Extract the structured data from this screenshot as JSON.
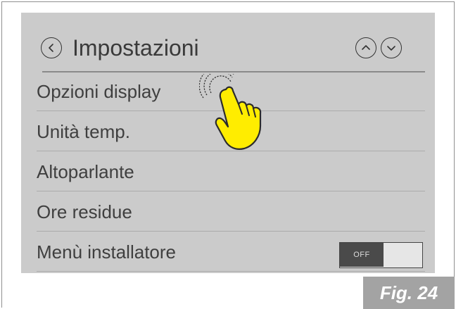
{
  "header": {
    "title": "Impostazioni",
    "icons": {
      "back": "chevron-left-icon",
      "up": "chevron-up-icon",
      "down": "chevron-down-icon"
    }
  },
  "menu": {
    "items": [
      {
        "label": "Opzioni display"
      },
      {
        "label": "Unità temp."
      },
      {
        "label": "Altoparlante"
      },
      {
        "label": "Ore residue"
      },
      {
        "label": "Menù installatore"
      }
    ]
  },
  "toggle": {
    "state_label": "OFF"
  },
  "figure": {
    "caption": "Fig. 24"
  },
  "gesture": {
    "icon": "tap-hand-icon",
    "color": "#ffed00"
  },
  "colors": {
    "screen_bg": "#cbcbcb",
    "text": "#3f3f3f",
    "caption_bg": "#a3a3a3"
  }
}
